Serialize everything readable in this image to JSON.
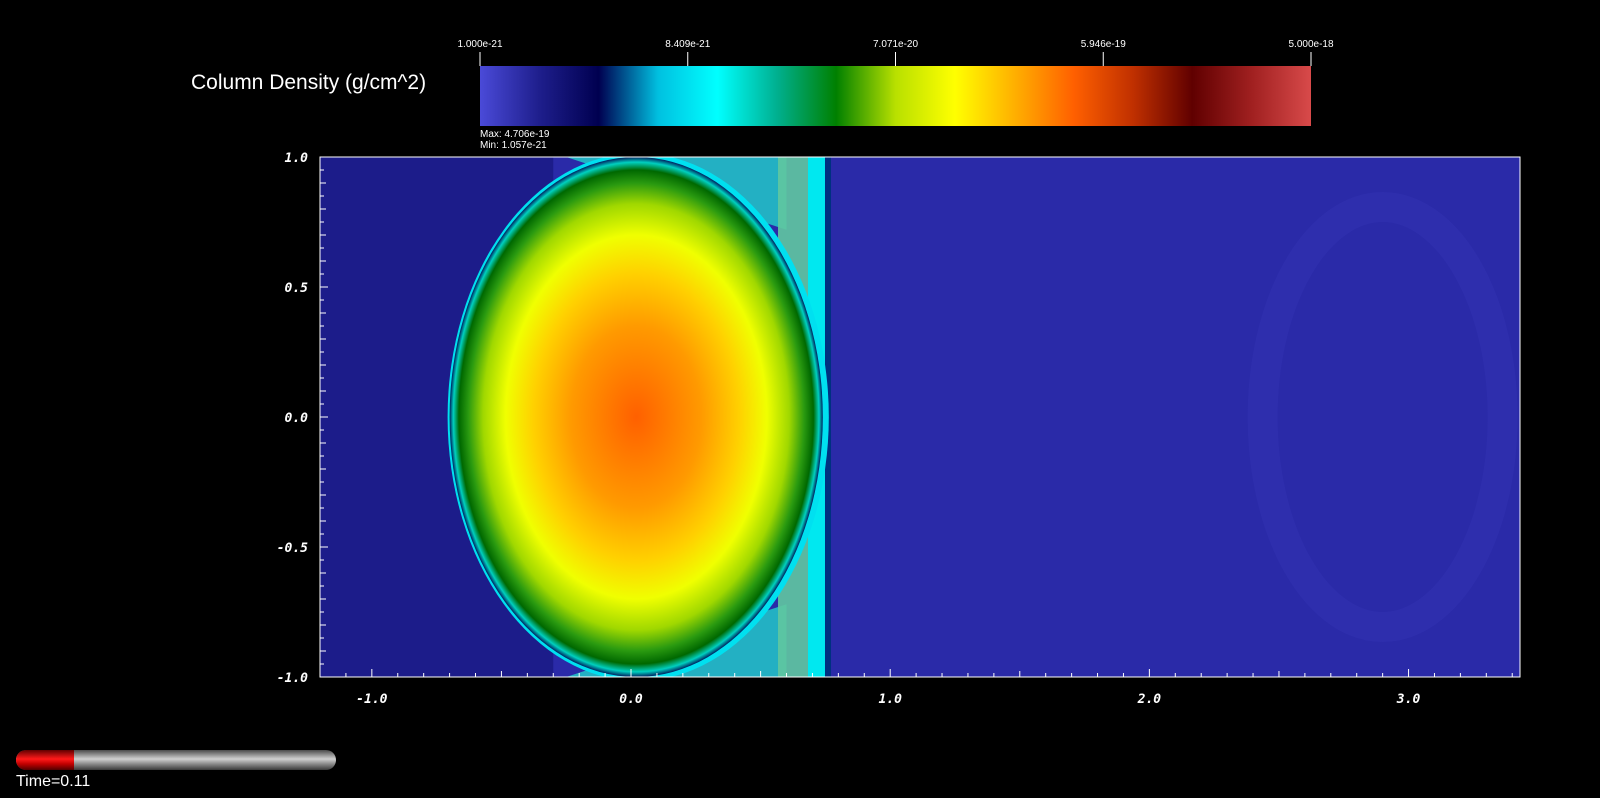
{
  "colorbar": {
    "title": "Column Density (g/cm^2)",
    "tick_labels": [
      "1.000e-21",
      "8.409e-21",
      "7.071e-20",
      "5.946e-19",
      "5.000e-18"
    ],
    "max_label": "Max:  4.706e-19",
    "min_label": "Min:  1.057e-21",
    "colors": [
      "#4a4ad8",
      "#1e1e8c",
      "#000050",
      "#00c0e0",
      "#00ffff",
      "#00b090",
      "#008000",
      "#b8e000",
      "#ffff00",
      "#ffb000",
      "#ff6000",
      "#c03000",
      "#600000",
      "#a02020",
      "#d84a4a"
    ],
    "scale": "log"
  },
  "time": {
    "label": "Time=0.11",
    "progress": 0.18
  },
  "chart_data": {
    "type": "heatmap",
    "title": "",
    "xlabel": "",
    "ylabel": "",
    "xlim": [
      -1.2,
      3.43
    ],
    "ylim": [
      -1.0,
      1.0
    ],
    "x_tick_labels": [
      "-1.0",
      "0.0",
      "1.0",
      "2.0",
      "3.0"
    ],
    "x_ticks": [
      -1.0,
      0.0,
      1.0,
      2.0,
      3.0
    ],
    "y_tick_labels": [
      "-1.0",
      "-0.5",
      "0.0",
      "0.5",
      "1.0"
    ],
    "y_ticks": [
      -1.0,
      -0.5,
      0.0,
      0.5,
      1.0
    ],
    "value_range": [
      1.057e-21,
      4.706e-19
    ],
    "background_value": 2e-21,
    "features": [
      {
        "name": "dense cloud",
        "center_x": 0.02,
        "center_y": 0.0,
        "radius_x": 0.72,
        "radius_y": 1.0,
        "peak_value": 4.7e-19
      },
      {
        "name": "shock front",
        "x": 0.76
      }
    ]
  }
}
